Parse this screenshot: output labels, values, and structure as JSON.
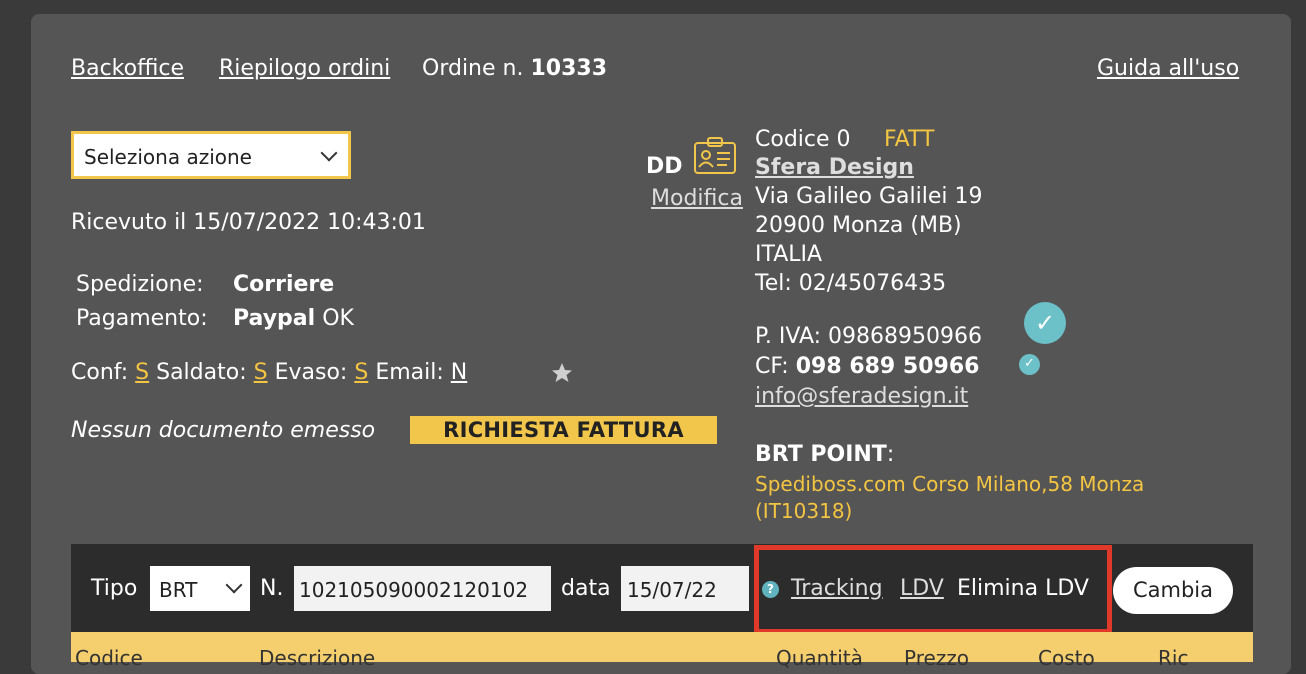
{
  "breadcrumb": {
    "backoffice": "Backoffice",
    "riepilogo": "Riepilogo ordini",
    "order_label": "Ordine n.",
    "order_number": "10333"
  },
  "guide_link": "Guida all'uso",
  "action_select": {
    "value": "Seleziona azione"
  },
  "received": "Ricevuto il 15/07/2022 10:43:01",
  "shipping": {
    "label": "Spedizione:",
    "value": "Corriere"
  },
  "payment": {
    "label": "Pagamento:",
    "value": "Paypal",
    "status": "OK"
  },
  "flags": [
    {
      "label": "Conf:",
      "value": "S"
    },
    {
      "label": "Saldato:",
      "value": "S"
    },
    {
      "label": "Evaso:",
      "value": "S"
    },
    {
      "label": "Email:",
      "value": "N"
    }
  ],
  "no_document": "Nessun documento emesso",
  "request_invoice": "RICHIESTA FATTURA",
  "customer": {
    "initials": "DD",
    "edit_link": "Modifica",
    "code": "Codice 0",
    "code_tag": "FATT",
    "name": "Sfera Design",
    "street": "Via Galileo Galilei 19",
    "city": "20900 Monza (MB)",
    "country": "ITALIA",
    "phone": "Tel: 02/45076435",
    "vat_label": "P. IVA:",
    "vat": "09868950966",
    "cf_label": "CF:",
    "cf": "098 689 50966",
    "email": "info@sferadesign.it"
  },
  "brt_point": {
    "label": "BRT POINT",
    "colon": ":",
    "line1": "Spediboss.com Corso Milano,58 Monza",
    "line2": "(IT10318)"
  },
  "shipment_bar": {
    "tipo_label": "Tipo",
    "tipo_value": "BRT",
    "n_label": "N.",
    "n_value": "102105090002120102",
    "data_label": "data",
    "data_value": "15/07/22",
    "help": "?",
    "tracking": "Tracking",
    "ldv": "LDV",
    "delete_ldv": "Elimina LDV",
    "change": "Cambia"
  },
  "table_headers": [
    "Codice",
    "Descrizione",
    "Quantità",
    "Prezzo",
    "Costo",
    "Ric"
  ],
  "colors": {
    "panel": "#555555",
    "background": "#3a3a3a",
    "accent_yellow": "#f2c64b",
    "highlight_red": "#e0392a",
    "verify_teal": "#6cc0c8"
  },
  "icons": [
    "chevron-down-icon",
    "id-card-icon",
    "star-icon",
    "verified-check-icon",
    "help-icon"
  ]
}
